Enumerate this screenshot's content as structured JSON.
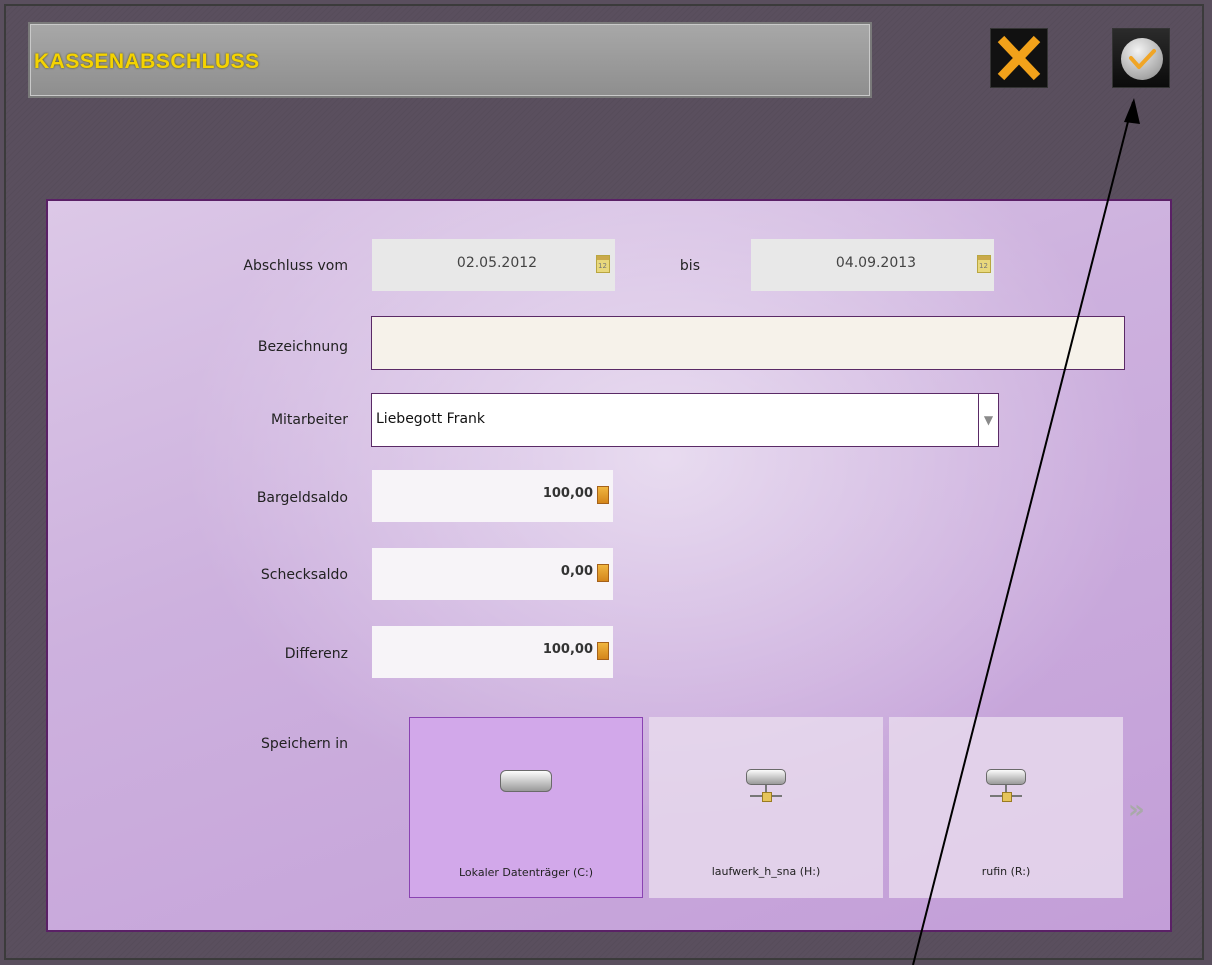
{
  "header": {
    "title": "KASSENABSCHLUSS"
  },
  "actions": {
    "close_icon": "close-icon",
    "confirm_icon": "check-icon"
  },
  "form": {
    "date_from_label": "Abschluss vom",
    "date_from_value": "02.05.2012",
    "date_to_label": "bis",
    "date_to_value": "04.09.2013",
    "description_label": "Bezeichnung",
    "description_value": "",
    "employee_label": "Mitarbeiter",
    "employee_value": "Liebegott Frank",
    "cash_label": "Bargeldsaldo",
    "cash_value": "100,00",
    "check_label": "Schecksaldo",
    "check_value": "0,00",
    "diff_label": "Differenz",
    "diff_value": "100,00",
    "save_label": "Speichern in"
  },
  "drives": [
    {
      "label": "Lokaler Datenträger (C:)",
      "selected": true,
      "icon": "local-drive-icon"
    },
    {
      "label": "laufwerk_h_sna (H:)",
      "selected": false,
      "icon": "network-drive-icon"
    },
    {
      "label": "rufin (R:)",
      "selected": false,
      "icon": "network-drive-icon"
    }
  ],
  "colors": {
    "accent": "#5a2066",
    "title_text": "#f5d300",
    "selected_tile": "#d2a8ea"
  }
}
